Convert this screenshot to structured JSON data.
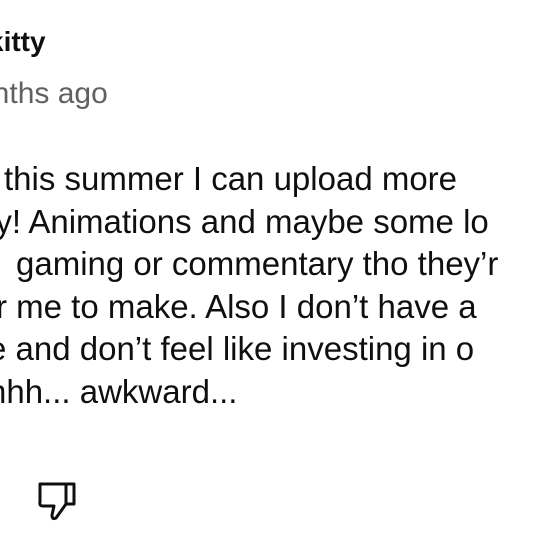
{
  "comment": {
    "author": "kitty",
    "timestamp": "onths ago",
    "body_lines": [
      "this summer I can upload more",
      "ly! Animations and maybe some lo",
      "gaming or commentary tho they’r",
      "r me to make. Also I don’t have a",
      "e and don’t feel like investing in o",
      "hhh... awkward..."
    ],
    "actions": {
      "dislike_icon": "thumbs-down-icon"
    }
  }
}
